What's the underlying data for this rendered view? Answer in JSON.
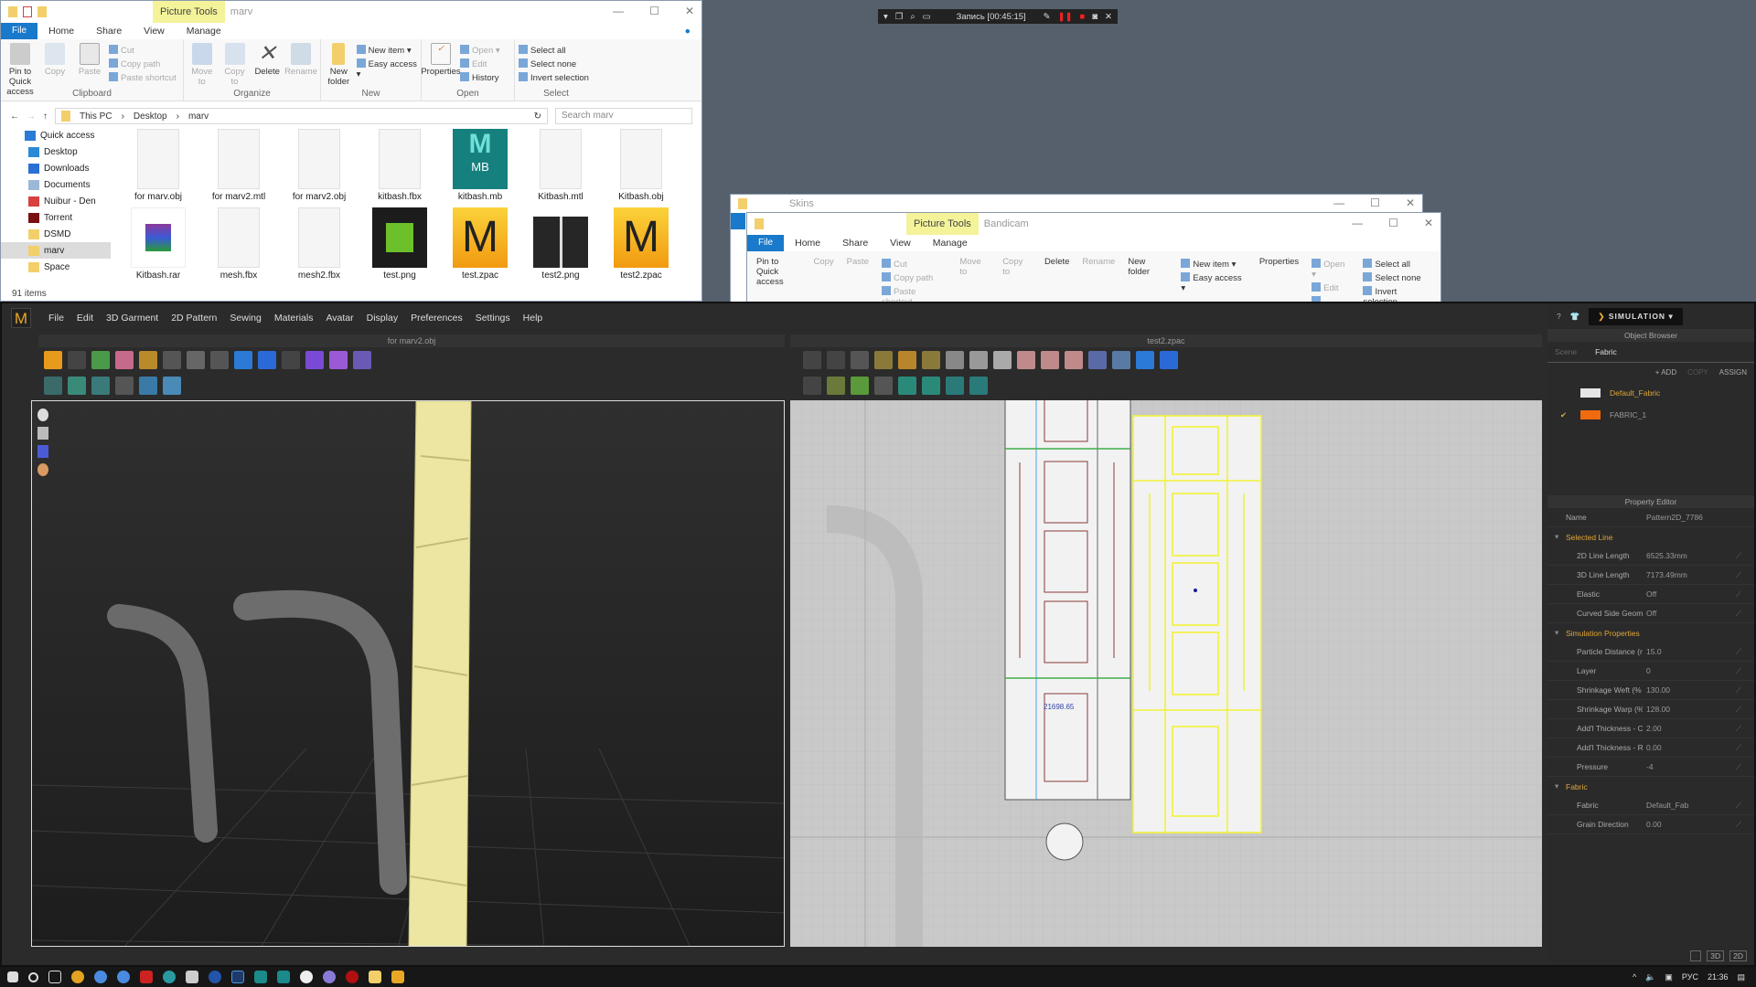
{
  "explorer_main": {
    "folder_title": "marv",
    "picture_tools": "Picture Tools",
    "tabs": [
      "File",
      "Home",
      "Share",
      "View",
      "Manage"
    ],
    "clipboard": {
      "pin": "Pin to Quick access",
      "copy": "Copy",
      "paste": "Paste",
      "cut": "Cut",
      "copy_path": "Copy path",
      "paste_shortcut": "Paste shortcut",
      "label": "Clipboard"
    },
    "organize": {
      "move": "Move to",
      "copy": "Copy to",
      "delete": "Delete",
      "rename": "Rename",
      "label": "Organize"
    },
    "new": {
      "new_folder": "New folder",
      "new_item": "New item ▾",
      "easy_access": "Easy access ▾",
      "label": "New"
    },
    "open": {
      "properties": "Properties",
      "open": "Open ▾",
      "edit": "Edit",
      "history": "History",
      "label": "Open"
    },
    "select": {
      "all": "Select all",
      "none": "Select none",
      "invert": "Invert selection",
      "label": "Select"
    },
    "breadcrumb": [
      "This PC",
      "Desktop",
      "marv"
    ],
    "search_placeholder": "Search marv",
    "nav": [
      {
        "label": "Quick access",
        "color": "#2a7bd6"
      },
      {
        "label": "Desktop",
        "color": "#2a8ad6"
      },
      {
        "label": "Downloads",
        "color": "#2a6fd6"
      },
      {
        "label": "Documents",
        "color": "#9bb8d8"
      },
      {
        "label": "Nuibur - Den",
        "color": "#d94040"
      },
      {
        "label": "Torrent",
        "color": "#7a1010"
      },
      {
        "label": "DSMD",
        "color": "#f2cf6a"
      },
      {
        "label": "marv",
        "color": "#f2cf6a"
      },
      {
        "label": "Space",
        "color": "#f2cf6a"
      }
    ],
    "files": [
      {
        "name": "for marv.obj",
        "type": "doc"
      },
      {
        "name": "for marv2.mtl",
        "type": "doc"
      },
      {
        "name": "for marv2.obj",
        "type": "doc"
      },
      {
        "name": "kitbash.fbx",
        "type": "doc"
      },
      {
        "name": "kitbash.mb",
        "type": "maya"
      },
      {
        "name": "Kitbash.mtl",
        "type": "doc"
      },
      {
        "name": "Kitbash.obj",
        "type": "doc"
      },
      {
        "name": "Kitbash.rar",
        "type": "rar"
      },
      {
        "name": "mesh.fbx",
        "type": "doc"
      },
      {
        "name": "mesh2.fbx",
        "type": "doc"
      },
      {
        "name": "test.png",
        "type": "png-green"
      },
      {
        "name": "test.zpac",
        "type": "zpac"
      },
      {
        "name": "test2.png",
        "type": "png-dark"
      },
      {
        "name": "test2.zpac",
        "type": "zpac"
      }
    ],
    "maya_badge": "MB",
    "zpac_letter": "M",
    "status": "91 items"
  },
  "explorer_skins": {
    "title": "Skins"
  },
  "explorer_bandicam": {
    "title": "Bandicam",
    "picture_tools": "Picture Tools",
    "tabs": [
      "File",
      "Home",
      "Share",
      "View",
      "Manage"
    ]
  },
  "recorder": {
    "label": "Запись [00:45:15]"
  },
  "marvelous": {
    "menu": [
      "File",
      "Edit",
      "3D Garment",
      "2D Pattern",
      "Sewing",
      "Materials",
      "Avatar",
      "Display",
      "Preferences",
      "Settings",
      "Help"
    ],
    "view3d_title": "for marv2.obj",
    "view2d_title": "test2.zpac",
    "measure_label": "21698.65",
    "mode": "SIMULATION",
    "object_browser": {
      "title": "Object Browser",
      "tabs": [
        "Scene",
        "Fabric"
      ],
      "add": "+ ADD",
      "copy": "COPY",
      "assign": "ASSIGN",
      "fabrics": [
        {
          "name": "Default_Fabric",
          "color": "#e6e6e6",
          "checked": false
        },
        {
          "name": "FABRIC_1",
          "color": "#f06a10",
          "checked": true
        }
      ]
    },
    "property_editor": {
      "title": "Property Editor",
      "name_label": "Name",
      "name_value": "Pattern2D_7786",
      "sections": [
        {
          "title": "Selected Line",
          "rows": [
            {
              "k": "2D Line Length",
              "v": "6525.33mm"
            },
            {
              "k": "3D Line Length",
              "v": "7173.49mm"
            },
            {
              "k": "Elastic",
              "v": "Off"
            },
            {
              "k": "Curved Side Geome",
              "v": "Off"
            }
          ]
        },
        {
          "title": "Simulation Properties",
          "rows": [
            {
              "k": "Particle Distance (m",
              "v": "15.0"
            },
            {
              "k": "Layer",
              "v": "0"
            },
            {
              "k": "Shrinkage Weft (%",
              "v": "130.00"
            },
            {
              "k": "Shrinkage Warp (%",
              "v": "128.00"
            },
            {
              "k": "Add'l Thickness - Collision",
              "v": "2.00"
            },
            {
              "k": "Add'l Thickness - Rendering",
              "v": "0.00"
            },
            {
              "k": "Pressure",
              "v": "-4"
            }
          ]
        },
        {
          "title": "Fabric",
          "rows": [
            {
              "k": "Fabric",
              "v": "Default_Fab"
            },
            {
              "k": "Grain Direction",
              "v": "0.00"
            }
          ]
        }
      ]
    },
    "view_buttons": [
      "",
      "3D",
      "2D"
    ]
  },
  "taskbar": {
    "lang": "РУС",
    "time": "21:36"
  },
  "colors": {
    "accent_yellow": "#e0a638",
    "selected_pattern": "#f2f23a",
    "ribbon_file": "#1979ca"
  }
}
